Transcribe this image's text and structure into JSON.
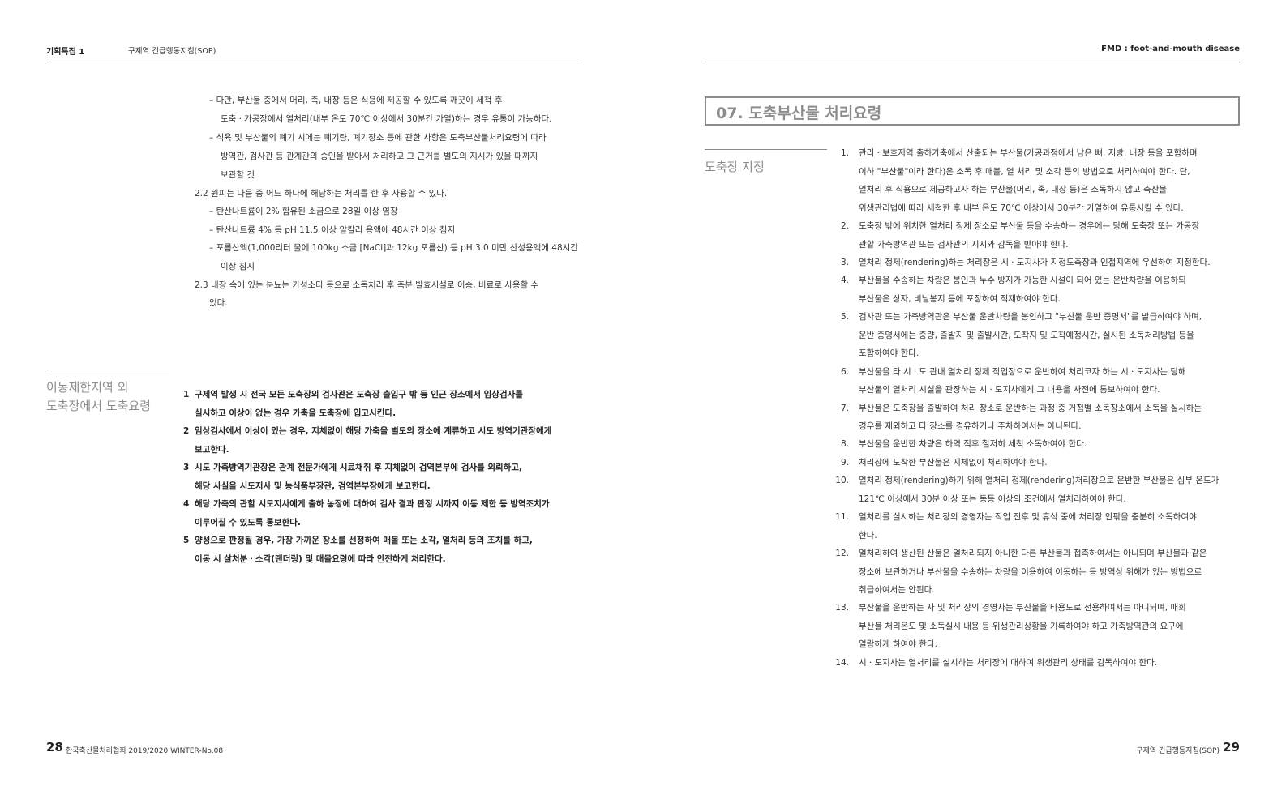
{
  "left_page": {
    "header_title": "기획특집 1",
    "header_sub": "구제역 긴급행동지침(SOP)",
    "top_block": [
      "– 다만, 부산물 중에서 머리, 족, 내장 등은 식용에 제공할 수 있도록 깨끗이 세척 후",
      "도축ㆍ가공장에서 열처리(내부 온도 70℃ 이상에서 30분간 가열)하는 경우 유통이  가능하다.",
      "– 식육 및 부산물의 폐기 시에는 폐기량, 폐기장소 등에 관한 사항은 도축부산물처리요령에 따라",
      "방역관, 검사관 등 관계관의 승인을 받아서 처리하고 그 근거를 별도의 지시가 있을 때까지",
      "보관할 것",
      "2.2 원피는 다음 중 어느 하나에 해당하는 처리를 한 후 사용할 수 있다.",
      "– 탄산나트륨이 2% 함유된 소금으로 28일 이상 염장",
      "– 탄산나트륨 4% 등 pH 11.5 이상 알칼리 용액에 48시간 이상 침지",
      "– 포름산액(1,000리터 물에 100kg 소금 [NaCl]과 12kg 포름산) 등 pH 3.0 미만 산성용액에 48시간",
      "이상 침지",
      "2.3 내장 속에 있는 분뇨는 가성소다 등으로 소독처리 후 축분 발효시설로 이송, 비료로 사용할 수",
      "있다."
    ],
    "side_heading": [
      "이동제한지역 외",
      "도축장에서 도축요령"
    ],
    "items": [
      {
        "num": "1",
        "lines": [
          "구제역 발생 시 전국 모든 도축장의 검사관은 도축장 출입구 밖 등 인근 장소에서 임상검사를",
          "실시하고 이상이 없는 경우 가축을 도축장에 입고시킨다."
        ]
      },
      {
        "num": "2",
        "lines": [
          "임상검사에서 이상이 있는 경우, 지체없이 해당 가축을 별도의 장소에 계류하고 시도 방역기관장에게",
          "보고한다."
        ]
      },
      {
        "num": "3",
        "lines": [
          "시도 가축방역기관장은 관계 전문가에게 시료채취 후 지체없이 검역본부에 검사를 의뢰하고,",
          "해당 사실을 시도지사 및 농식품부장관, 검역본부장에게 보고한다."
        ]
      },
      {
        "num": "4",
        "lines": [
          "해당 가축의 관할 시도지사에게 출하 농장에 대하여 검사 결과 판정 시까지 이동 제한 등 방역조치가",
          "이루어질 수 있도록 통보한다."
        ]
      },
      {
        "num": "5",
        "lines": [
          "양성으로 판정될 경우, 가장 가까운 장소를 선정하여 매몰 또는 소각, 열처리 등의 조치를 하고,",
          "이동 시 살처분ㆍ소각(랜더링) 및 매몰요령에 따라 안전하게 처리한다."
        ]
      }
    ],
    "page_number": "28",
    "footer_text": "한국축산물처리협회 2019/2020 WINTER-No.08"
  },
  "right_page": {
    "header_title": "FMD : foot-and-mouth disease",
    "section_title": "07. 도축부산물 처리요령",
    "side_heading": "도축장 지정",
    "items": [
      {
        "num": "1.",
        "lines": [
          "관리ㆍ보호지역 출하가축에서 산출되는 부산물(가공과정에서 남은 뼈, 지방, 내장 등을 포함하며",
          "이하 \"부산물\"이라 한다)은 소독 후 매몰, 열 처리 및 소각 등의 방법으로 처리하여야 한다. 단,",
          "열처리 후 식용으로 제공하고자 하는 부산물(머리, 족, 내장 등)은 소독하지 않고 축산물",
          "위생관리법에 따라 세척한 후 내부 온도 70℃ 이상에서 30분간 가열하여 유통시킬 수 있다."
        ]
      },
      {
        "num": "2.",
        "lines": [
          "도축장 밖에 위치한 열처리 정제 장소로 부산물 등을 수송하는 경우에는 당해 도축장 또는 가공장",
          "관할 가축방역관 또는 검사관의 지시와 감독을 받아야 한다."
        ]
      },
      {
        "num": "3.",
        "lines": [
          "열처리 정제(rendering)하는 처리장은 시ㆍ도지사가 지정도축장과 인접지역에 우선하여 지정한다."
        ]
      },
      {
        "num": "4.",
        "lines": [
          "부산물을 수송하는 차량은 봉인과 누수 방지가 가능한 시설이 되어 있는 운반차량을 이용하되",
          "부산물은 상자, 비닐봉지 등에 포장하여 적재하여야 한다."
        ]
      },
      {
        "num": "5.",
        "lines": [
          "검사관 또는 가축방역관은 부산물 운반차량을 봉인하고 \"부산물 운반 증명서\"를 발급하여야 하며,",
          "운반 증명서에는 중량, 출발지 및 출발시간, 도착지 및 도착예정시간, 실시된 소독처리방법 등을",
          "포함하여야 한다."
        ]
      },
      {
        "num": "6.",
        "lines": [
          "부산물을 타 시ㆍ도 관내 열처리 정제 작업장으로 운반하여 처리코자 하는 시ㆍ도지사는 당해",
          "부산물의 열처리 시설을 관장하는 시ㆍ도지사에게 그 내용을 사전에 통보하여야 한다."
        ]
      },
      {
        "num": "7.",
        "lines": [
          "부산물은 도축장을 출발하여 처리 장소로 운반하는 과정 중 거점별 소독장소에서 소독을 실시하는",
          "경우를 제외하고 타 장소를 경유하거나 주차하여서는 아니된다."
        ]
      },
      {
        "num": "8.",
        "lines": [
          "부산물을 운반한 차량은 하역 직후 철저히 세척 소독하여야 한다."
        ]
      },
      {
        "num": "9.",
        "lines": [
          "처리장에 도착한 부산물은 지체없이 처리하여야 한다."
        ]
      },
      {
        "num": "10.",
        "lines": [
          "열처리 정제(rendering)하기 위해 열처리 정제(rendering)처리장으로 운반한 부산물은 심부 온도가",
          "121℃ 이상에서 30분 이상 또는 동등 이상의 조건에서 열처리하여야 한다."
        ]
      },
      {
        "num": "11.",
        "lines": [
          "열처리를 실시하는 처리장의 경영자는 작업 전후 및 휴식 중에 처리장 안팎을 충분히 소독하여야",
          "한다."
        ]
      },
      {
        "num": "12.",
        "lines": [
          "열처리하여 생산된 산물은 열처리되지 아니한 다른 부산물과 접촉하여서는 아니되며 부산물과 같은",
          "장소에 보관하거나 부산물을 수송하는 차량을 이용하여 이동하는 등 방역상 위해가 있는 방법으로",
          "취급하여서는 안된다."
        ]
      },
      {
        "num": "13.",
        "lines": [
          "부산물을 운반하는 자 및 처리장의 경영자는 부산물을 타용도로 전용하여서는 아니되며, 매회",
          "부산물 처리온도 및 소독실시 내용 등 위생관리상황을 기록하여야 하고 가축방역관의 요구에",
          "열람하게 하여야 한다."
        ]
      },
      {
        "num": "14.",
        "lines": [
          "시ㆍ도지사는 열처리를 실시하는 처리장에 대하여 위생관리 상태를 감독하여야 한다."
        ]
      }
    ],
    "footer_text": "구제역 긴급행동지침(SOP)",
    "page_number": "29"
  }
}
